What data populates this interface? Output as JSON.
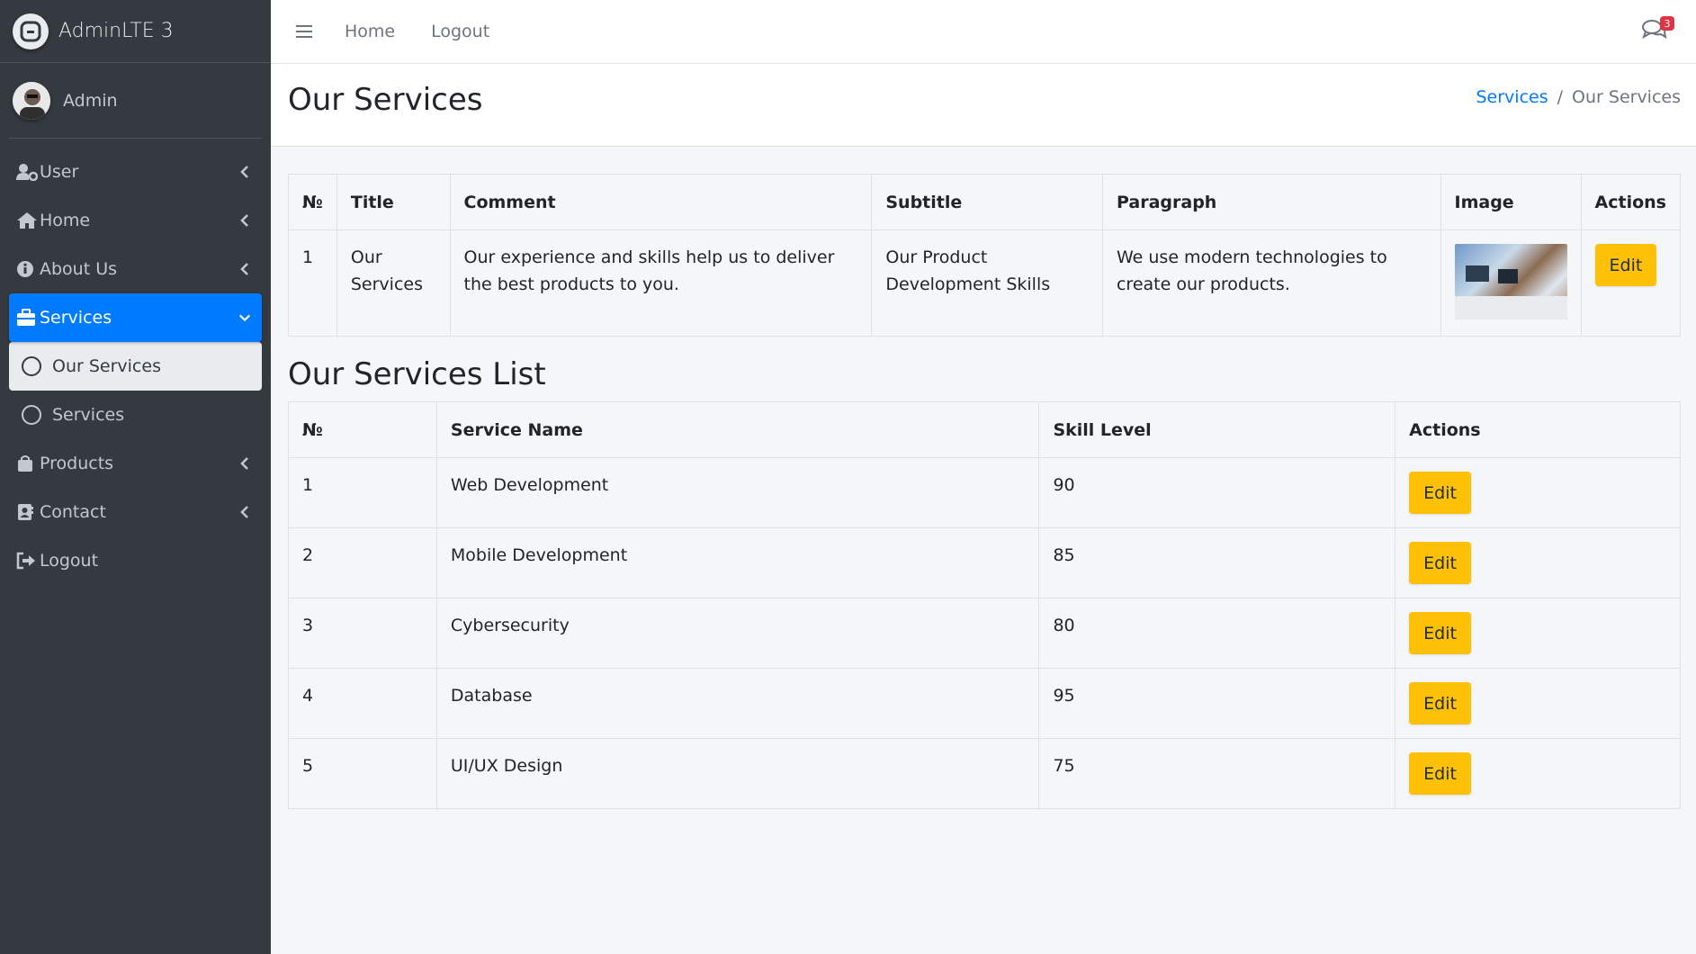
{
  "brand": {
    "title": "AdminLTE 3"
  },
  "user": {
    "name": "Admin"
  },
  "sidebar": {
    "items": [
      {
        "label": "User",
        "icon": "user-cog-icon"
      },
      {
        "label": "Home",
        "icon": "home-icon"
      },
      {
        "label": "About Us",
        "icon": "info-circle-icon"
      },
      {
        "label": "Services",
        "icon": "briefcase-icon",
        "active": true
      },
      {
        "label": "Products",
        "icon": "shopping-bag-icon"
      },
      {
        "label": "Contact",
        "icon": "address-book-icon"
      },
      {
        "label": "Logout",
        "icon": "sign-out-icon"
      }
    ],
    "sub_items": [
      {
        "label": "Our Services",
        "selected": true
      },
      {
        "label": "Services"
      }
    ]
  },
  "topnav": {
    "home": "Home",
    "logout": "Logout",
    "chat_badge": "3"
  },
  "header": {
    "title": "Our Services",
    "breadcrumb": {
      "link": "Services",
      "separator": "/",
      "current": "Our Services"
    }
  },
  "table1": {
    "headers": [
      "№",
      "Title",
      "Comment",
      "Subtitle",
      "Paragraph",
      "Image",
      "Actions"
    ],
    "rows": [
      {
        "no": "1",
        "title": "Our Services",
        "comment": "Our experience and skills help us to deliver the best products to you.",
        "subtitle": "Our Product Development Skills",
        "paragraph": "We use modern technologies to create our products.",
        "action": "Edit"
      }
    ]
  },
  "section2": {
    "title": "Our Services List"
  },
  "table2": {
    "headers": [
      "№",
      "Service Name",
      "Skill Level",
      "Actions"
    ],
    "rows": [
      {
        "no": "1",
        "name": "Web Development",
        "level": "90",
        "action": "Edit"
      },
      {
        "no": "2",
        "name": "Mobile Development",
        "level": "85",
        "action": "Edit"
      },
      {
        "no": "3",
        "name": "Cybersecurity",
        "level": "80",
        "action": "Edit"
      },
      {
        "no": "4",
        "name": "Database",
        "level": "95",
        "action": "Edit"
      },
      {
        "no": "5",
        "name": "UI/UX Design",
        "level": "75",
        "action": "Edit"
      }
    ]
  },
  "colors": {
    "sidebar_bg": "#343a40",
    "active": "#007bff",
    "edit_button": "#ffc107",
    "badge": "#dc3545"
  }
}
